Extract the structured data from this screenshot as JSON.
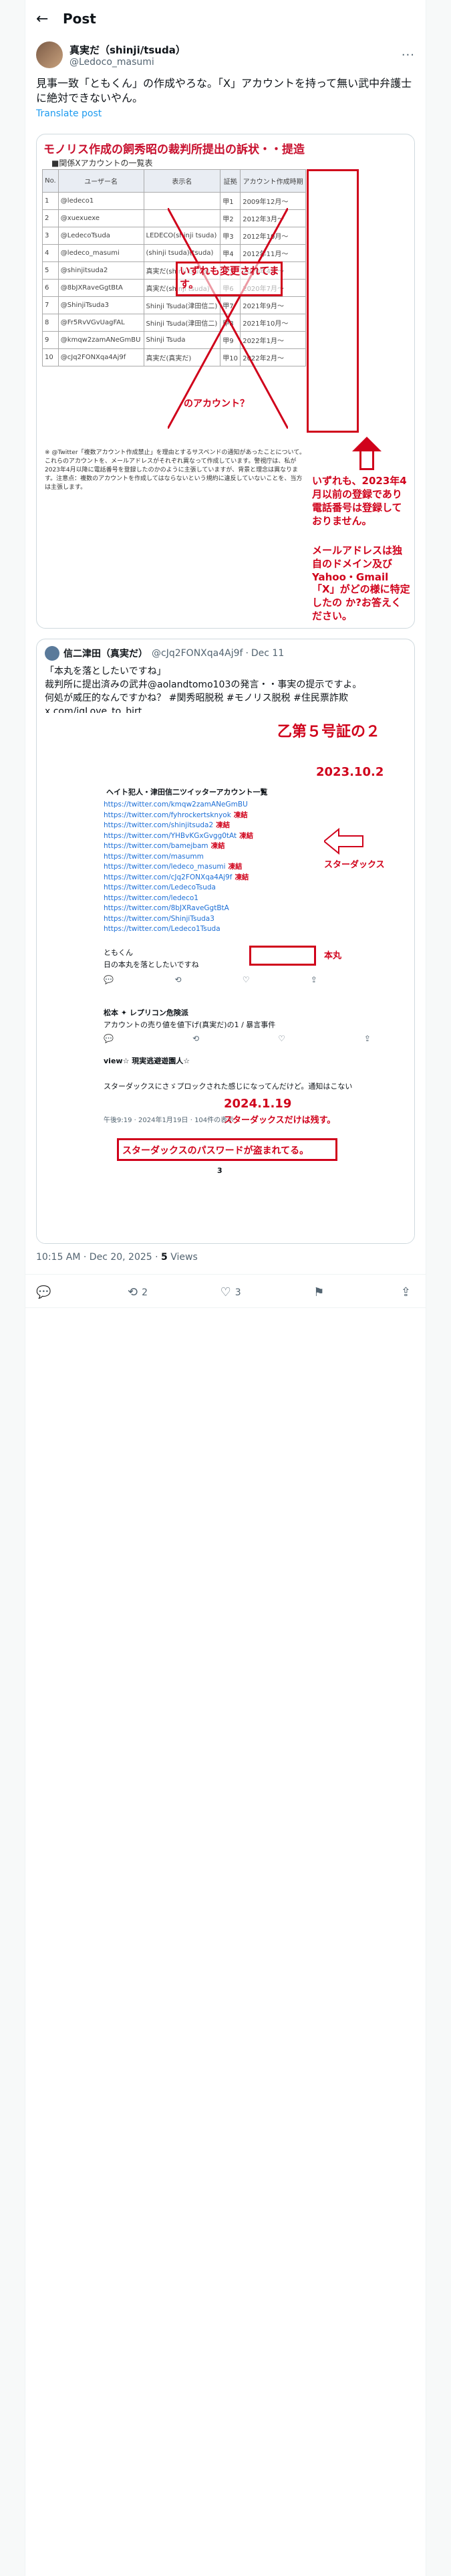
{
  "header": {
    "title": "Post",
    "back_icon": "←"
  },
  "author": {
    "name": "真実だ（shinji/tsuda）",
    "handle": "@Ledoco_masumi",
    "more": "···"
  },
  "post": {
    "text": "見事一致「ともくん」の作成やろな。「X」アカウントを持って無い武中弁護士に絶対できないやん。",
    "translate": "Translate post"
  },
  "image1": {
    "title": "モノリス作成の飼秀昭の裁判所提出の訴状・・提造",
    "subtitle": "■関係Xアカウントの一覧表",
    "columns": [
      "No.",
      "ユーザー名",
      "表示名",
      "証拠",
      "アカウント作成時期"
    ],
    "rows": [
      [
        "1",
        "@ledeco1",
        "",
        "甲1",
        "2009年12月〜"
      ],
      [
        "2",
        "@xuexuexe",
        "",
        "甲2",
        "2012年3月〜"
      ],
      [
        "3",
        "@LedecoTsuda",
        "LEDECO(shinji tsuda)",
        "甲3",
        "2012年10月〜"
      ],
      [
        "4",
        "@ledeco_masumi",
        "(shinji tsuda)(tsuda)",
        "甲4",
        "2012年11月〜"
      ],
      [
        "5",
        "@shinjitsuda2",
        "真実だ(shinji tsuda)",
        "甲5",
        "2020年4月〜"
      ],
      [
        "6",
        "@8bJXRaveGgtBtA",
        "真実だ(shinji tsuda)",
        "甲6",
        "2020年7月〜"
      ],
      [
        "7",
        "@ShinjiTsuda3",
        "Shinji Tsuda(津田信二)",
        "甲7",
        "2021年9月〜"
      ],
      [
        "8",
        "@Fr5RvVGvUagFAL",
        "Shinji Tsuda(津田信二)",
        "甲8",
        "2021年10月〜"
      ],
      [
        "9",
        "@kmqw2zamANeGmBU",
        "Shinji Tsuda",
        "甲9",
        "2022年1月〜"
      ],
      [
        "10",
        "@cJq2FONXqa4Aj9f",
        "真実だ(真実だ)",
        "甲10",
        "2022年2月〜"
      ]
    ],
    "note_overlay": "いずれも変更されてます。",
    "note_account": "のアカウント？",
    "note_right1": "いずれも、2023年4月以前の登録であり電話番号は登録しておりません。",
    "note_right2": "メールアドレスは独自のドメイン及び Yahoo・Gmail",
    "note_right3": "「X」がどの様に特定したの か?お答えください。",
    "small_text": "※ @Twitter「複数アカウント作成禁止」を理由とするサスペンドの通知があったことについて。これらのアカウントを、メールアドレスがそれぞれ異なって作成しています。警視庁は、私が2023年4月以降に電話番号を登録したのかのように主張していますが、背景と理念は異なります。注意点：複数のアカウントを作成してはならないという規約に違反していないことを、当方は主張します。"
  },
  "quote": {
    "name": "信二津田（真実だ）",
    "handle": "@cJq2FONXqa4Aj9f",
    "date": "Dec 11",
    "text": "「本丸を落としたいですね」\n裁判所に提出済みの武井@aolandtomo103の発言・・事実の提示ですよ。\n何処が威圧的なんですかね？ #関秀昭脱税 #モノリス脱税 #住民票詐欺 x.com/iqLove_to_birt…",
    "stamp": "乙第５号証の２",
    "date1": "2023.10.2",
    "date2": "2024.1.19",
    "label_stardust": "スターダックス",
    "label_honmaru": "本丸",
    "label_only": "スターダックスだけは残す。",
    "label_stolen": "スターダックスのパスワードが盗まれてる。",
    "list_title": "ヘイト犯人・津田信二ツイッターアカウント一覧",
    "links": [
      [
        "https://twitter.com/kmqw2zamANeGmBU",
        ""
      ],
      [
        "https://twitter.com/fyhrockertsknyok",
        "凍結"
      ],
      [
        "https://twitter.com/shinjitsuda2",
        "凍結"
      ],
      [
        "https://twitter.com/YHBvKGxGvgg0tAt",
        "凍結"
      ],
      [
        "https://twitter.com/bamejbam",
        "凍結"
      ],
      [
        "https://twitter.com/masumm",
        ""
      ],
      [
        "https://twitter.com/ledeco_masumi",
        "凍結"
      ],
      [
        "https://twitter.com/cJq2FONXqa4Aj9f",
        "凍結"
      ],
      [
        "https://twitter.com/LedecoTsuda",
        ""
      ],
      [
        "https://twitter.com/ledeco1",
        ""
      ],
      [
        "https://twitter.com/8bJXRaveGgtBtA",
        ""
      ],
      [
        "https://twitter.com/ShinjiTsuda3",
        ""
      ],
      [
        "https://twitter.com/Ledeco1Tsuda",
        ""
      ]
    ],
    "inner_user1": "ともくん",
    "inner_text1": "日の本丸を落としたいですね",
    "inner_user2": "松本 ✦ レプリコン危険派",
    "inner_text2": "アカウントの売り値を値下げ(真実だ)の1 / 暴言事件",
    "inner_user3": "view☆ 現実逃避遊園人☆",
    "inner_text3": "スターダックスにさゞプロックされた感じになってんだけど。通知はこない",
    "inner_meta3": "午後9:19 · 2024年1月19日 · 104件の表示",
    "page_num": "3"
  },
  "meta": {
    "time": "10:15 AM · Dec 20, 2025 · ",
    "views_count": "5",
    "views_label": "Views"
  },
  "actions": {
    "reply": "",
    "retweet": "2",
    "like": "3",
    "bookmark": "",
    "share": ""
  }
}
